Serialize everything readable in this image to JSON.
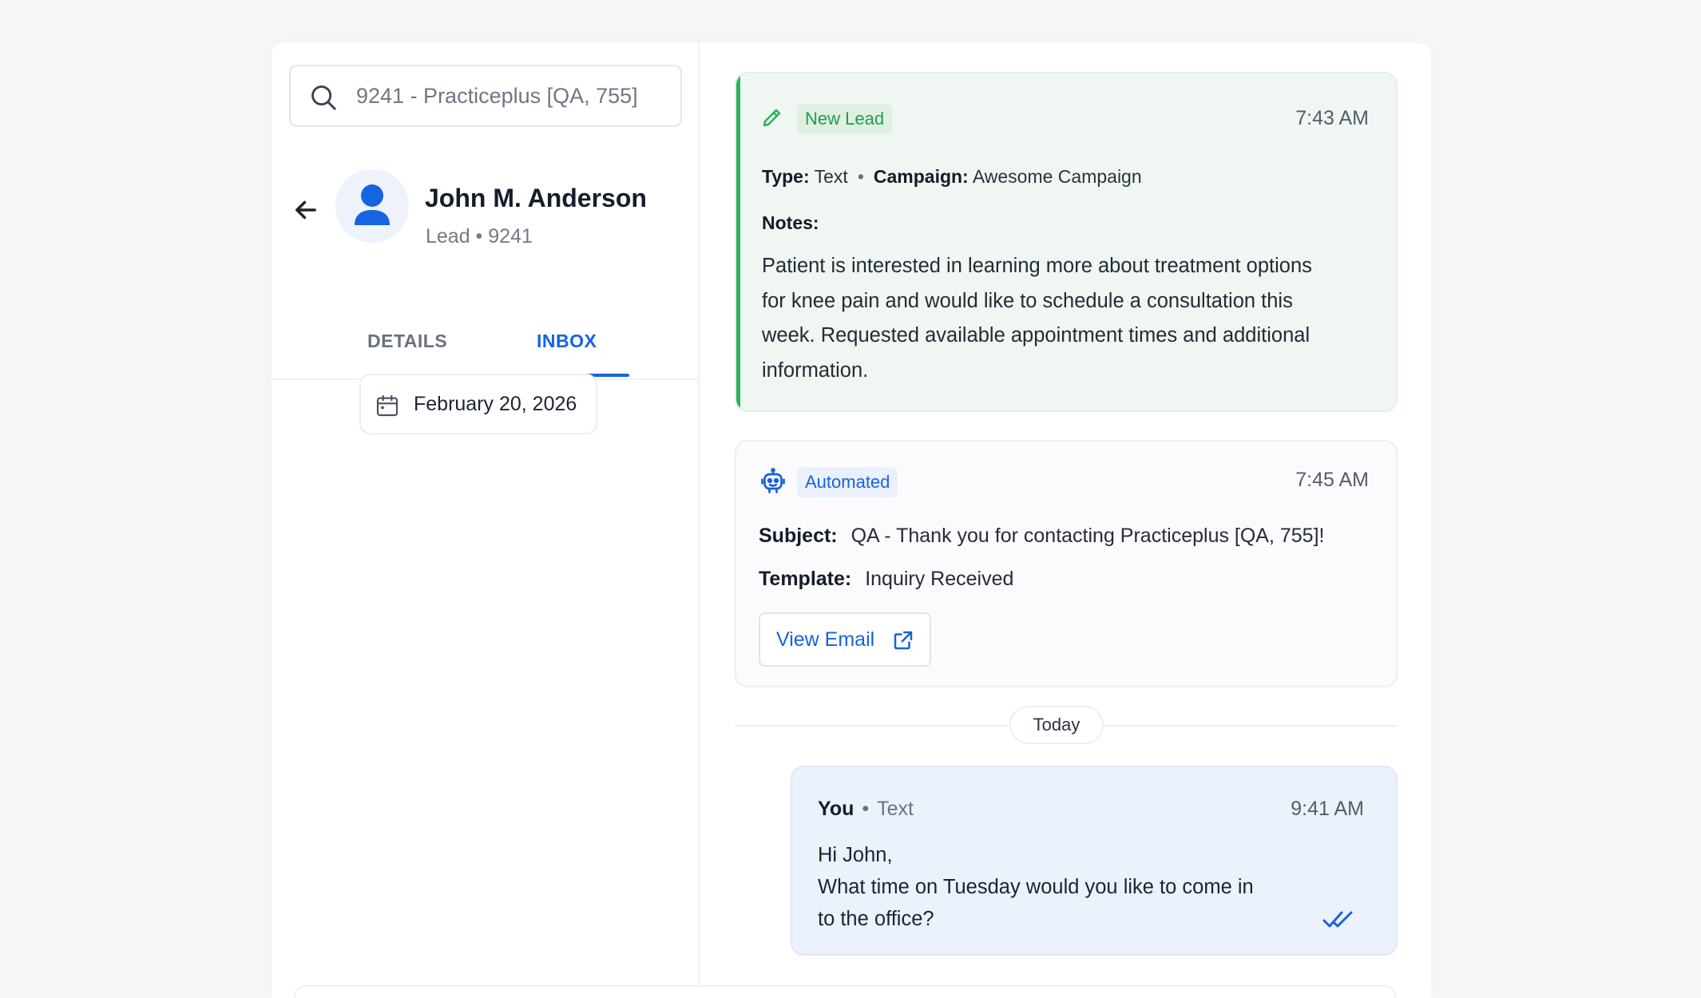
{
  "search": {
    "value": "9241 - Practiceplus [QA, 755]"
  },
  "contact": {
    "name": "John M. Anderson",
    "meta": "Lead • 9241"
  },
  "tabs": [
    {
      "label": "DETAILS",
      "active": false
    },
    {
      "label": "INBOX",
      "active": true
    }
  ],
  "date_filter": "February 20, 2026",
  "lead_card": {
    "badge": "New Lead",
    "time": "7:43 AM",
    "type_label": "Type:",
    "type_value": "Text",
    "campaign_label": "Campaign:",
    "campaign_value": "Awesome Campaign",
    "notes_label": "Notes:",
    "notes": "Patient is interested in learning more about treatment options for knee pain and would like to schedule a consultation this week. Requested available appointment times and additional information.",
    "accent_color": "#2bb35c"
  },
  "automated_card": {
    "badge": "Automated",
    "time": "7:45 AM",
    "subject_label": "Subject:",
    "subject": "QA - Thank you for contacting Practiceplus [QA, 755]!",
    "template_label": "Template:",
    "template": "Inquiry Received",
    "button_label": "View Email"
  },
  "divider_label": "Today",
  "message": {
    "sender": "You",
    "channel": "Text",
    "time": "9:41 AM",
    "line1": "Hi John,",
    "line2": "What time on Tuesday would you like to come in to the office?",
    "status_icon": "double-check-icon"
  },
  "colors": {
    "primary": "#1764e0",
    "lead_green": "#2bb35c",
    "message_bg": "#ecf2fc"
  }
}
